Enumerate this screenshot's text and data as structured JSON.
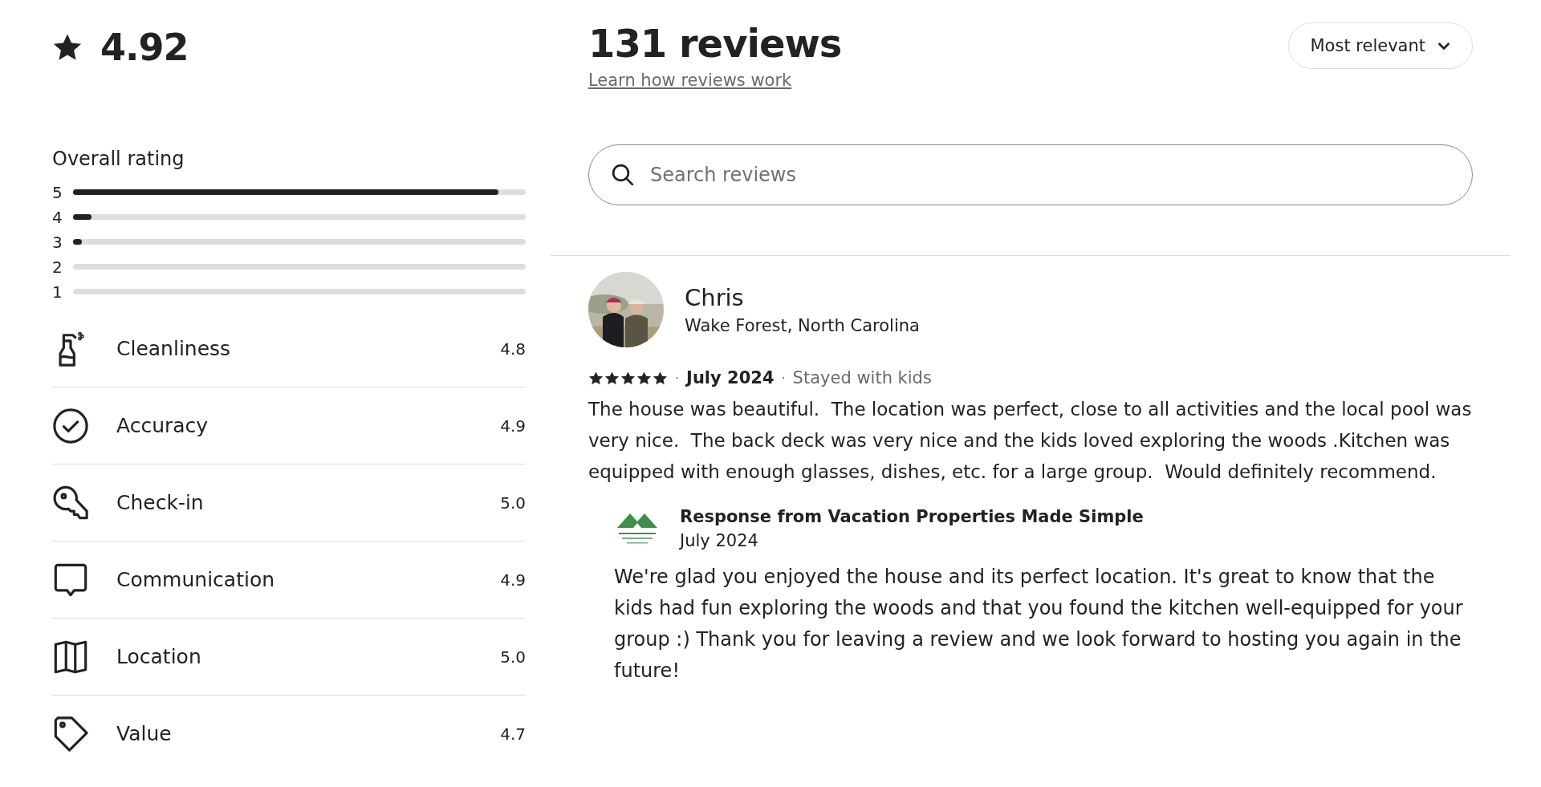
{
  "summary": {
    "rating": "4.92"
  },
  "overall_rating": {
    "title": "Overall rating",
    "bars": [
      {
        "label": "5",
        "level": 0.94
      },
      {
        "label": "4",
        "level": 0.04
      },
      {
        "label": "3",
        "level": 0.02
      },
      {
        "label": "2"
      },
      {
        "label": "1"
      }
    ]
  },
  "categories": [
    {
      "kind": "spray",
      "label": "Cleanliness",
      "score": "4.8"
    },
    {
      "kind": "check",
      "label": "Accuracy",
      "score": "4.9"
    },
    {
      "kind": "key",
      "label": "Check-in",
      "score": "5.0"
    },
    {
      "kind": "chat",
      "label": "Communication",
      "score": "4.9"
    },
    {
      "kind": "map",
      "label": "Location",
      "score": "5.0"
    },
    {
      "kind": "tag",
      "label": "Value",
      "score": "4.7"
    }
  ],
  "reviews_header": {
    "title": "131 reviews",
    "link": "Learn how reviews work",
    "sort": "Most relevant"
  },
  "search": {
    "placeholder": "Search reviews"
  },
  "reviews": [
    {
      "name": "Chris",
      "location": "Wake Forest, North Carolina",
      "stars": 5,
      "sep1": "·",
      "date": "July 2024",
      "sep2": "·",
      "trip": "Stayed with kids",
      "text": "The house was beautiful.  The location was perfect, close to all activities and the local pool was very nice.  The back deck was very nice and the kids loved exploring the woods .Kitchen was equipped with enough glasses, dishes, etc. for a large group.  Would definitely recommend.",
      "response": {
        "title": "Response from Vacation Properties Made Simple",
        "date": "July 2024",
        "text": "We're glad you enjoyed the house and its perfect location. It's great to know that the kids had fun exploring the woods and that you found the kitchen well-equipped for your group :) Thank you for leaving a review and we look forward to hosting you again in the future!"
      }
    }
  ]
}
